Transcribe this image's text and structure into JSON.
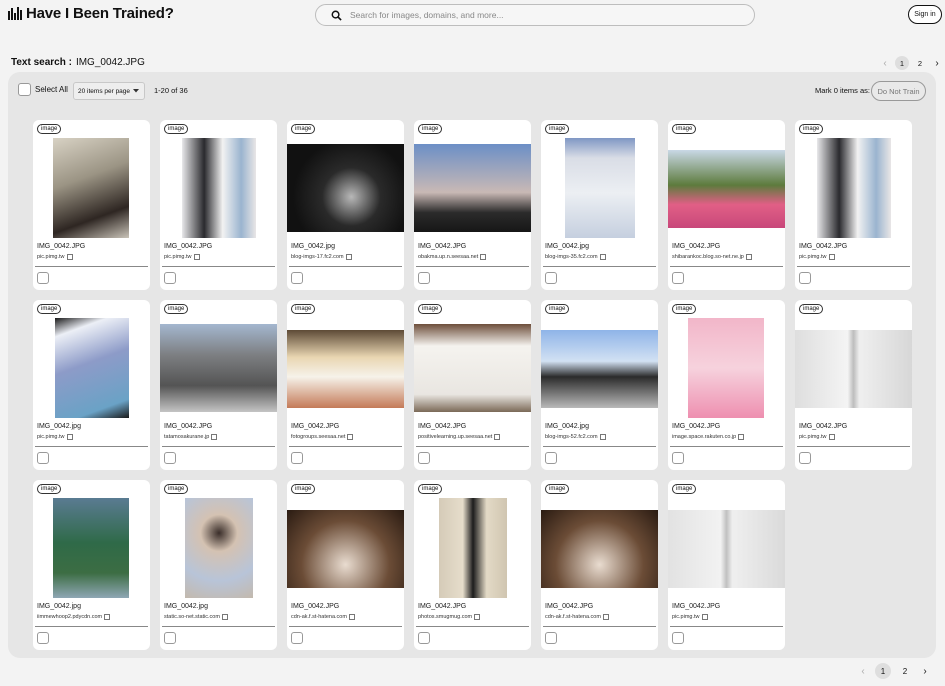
{
  "app": {
    "title": "Have I Been Trained?"
  },
  "search": {
    "placeholder": "Search for images, domains, and more..."
  },
  "auth": {
    "signin_label": "Sign in"
  },
  "query": {
    "label": "Text search :",
    "value": "IMG_0042.JPG"
  },
  "pagination": {
    "prev": "‹",
    "pages": [
      "1",
      "2"
    ],
    "current": "1",
    "next": "›"
  },
  "toolbar": {
    "select_all": "Select All",
    "per_page": "20 items per page",
    "range": "1-20 of 36",
    "mark_label": "Mark 0 items as:",
    "do_not_train": "Do Not Train"
  },
  "icons": {
    "search": "search-icon",
    "logo": "bar-chart-logo-icon",
    "external": "external-link-icon",
    "dropdown": "chevron-down-icon"
  },
  "results": [
    {
      "badge": "image",
      "filename": "IMG_0042.JPG",
      "domain": "pic.pimg.tw"
    },
    {
      "badge": "image",
      "filename": "IMG_0042.JPG",
      "domain": "pic.pimg.tw"
    },
    {
      "badge": "image",
      "filename": "IMG_0042.jpg",
      "domain": "blog-imgs-17.fc2.com"
    },
    {
      "badge": "image",
      "filename": "IMG_0042.JPG",
      "domain": "obakma.up.n.seesaa.net"
    },
    {
      "badge": "image",
      "filename": "IMG_0042.jpg",
      "domain": "blog-imgs-35.fc2.com"
    },
    {
      "badge": "image",
      "filename": "IMG_0042.JPG",
      "domain": "shibarankoc.blog.so-net.ne.jp"
    },
    {
      "badge": "image",
      "filename": "IMG_0042.JPG",
      "domain": "pic.pimg.tw"
    },
    {
      "badge": "image",
      "filename": "IMG_0042.jpg",
      "domain": "pic.pimg.tw"
    },
    {
      "badge": "image",
      "filename": "IMG_0042.JPG",
      "domain": "tatamosakurane.jp"
    },
    {
      "badge": "image",
      "filename": "IMG_0042.JPG",
      "domain": "fotogroups.seesaa.net"
    },
    {
      "badge": "image",
      "filename": "IMG_0042.JPG",
      "domain": "positivelearning.up.seesaa.net"
    },
    {
      "badge": "image",
      "filename": "IMG_0042.jpg",
      "domain": "blog-imgs-52.fc2.com"
    },
    {
      "badge": "image",
      "filename": "IMG_0042.JPG",
      "domain": "image.space.rakuten.co.jp"
    },
    {
      "badge": "image",
      "filename": "IMG_0042.JPG",
      "domain": "pic.pimg.tw"
    },
    {
      "badge": "image",
      "filename": "IMG_0042.jpg",
      "domain": "iimmewhoop2.pdycdn.com"
    },
    {
      "badge": "image",
      "filename": "IMG_0042.jpg",
      "domain": "static.so-net.static.com"
    },
    {
      "badge": "image",
      "filename": "IMG_0042.JPG",
      "domain": "cdn-ak.f.st-hatena.com"
    },
    {
      "badge": "image",
      "filename": "IMG_0042.JPG",
      "domain": "photos.smugmug.com"
    },
    {
      "badge": "image",
      "filename": "IMG_0042.JPG",
      "domain": "cdn-ak.f.st-hatena.com"
    },
    {
      "badge": "image",
      "filename": "IMG_0042.JPG",
      "domain": "pic.pimg.tw"
    }
  ]
}
